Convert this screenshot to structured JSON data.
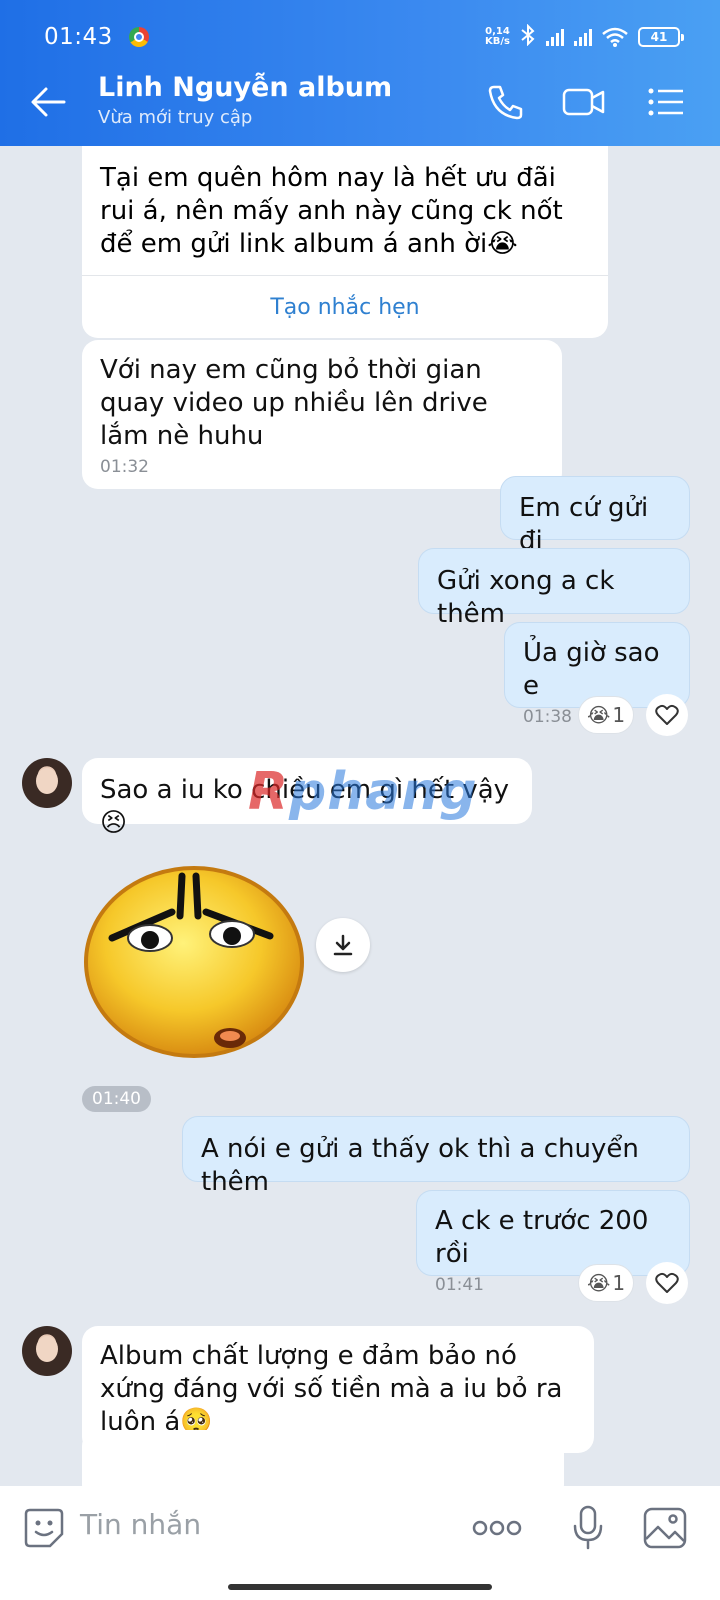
{
  "status_bar": {
    "time": "01:43",
    "net_speed_value": "0,14",
    "net_speed_unit": "KB/s",
    "battery": "41"
  },
  "header": {
    "contact_name": "Linh Nguyễn album",
    "contact_status": "Vừa mới truy cập",
    "icons": [
      "back-arrow-icon",
      "phone-icon",
      "video-call-icon",
      "menu-list-icon"
    ]
  },
  "messages": [
    {
      "direction": "in",
      "text": "Tại em quên hôm nay là hết ưu đãi rui á, nên mấy anh này cũng ck nốt để em gửi link album á anh ời😭",
      "action": "Tạo nhắc hẹn"
    },
    {
      "direction": "in",
      "text": "Với nay em cũng bỏ thời gian quay video up nhiều lên drive lắm nè huhu",
      "time": "01:32"
    },
    {
      "direction": "out",
      "text": "Em cứ gửi đi"
    },
    {
      "direction": "out",
      "text": "Gửi xong a ck thêm"
    },
    {
      "direction": "out",
      "text": "Ủa giờ sao e",
      "time": "01:38",
      "reaction": {
        "emoji": "😭",
        "count": "1"
      }
    },
    {
      "direction": "in",
      "text": "Sao a iu ko chiều em gì hết vậy 😣"
    },
    {
      "direction": "in",
      "type": "sticker",
      "sticker": "sad-emoji-sticker",
      "time": "01:40"
    },
    {
      "direction": "out",
      "text": "A nói e gửi a thấy ok thì a chuyển thêm"
    },
    {
      "direction": "out",
      "text": "A ck e trước 200 rồi",
      "time": "01:41",
      "reaction": {
        "emoji": "😭",
        "count": "1"
      }
    },
    {
      "direction": "in",
      "text": "Album chất lượng e đảm bảo nó xứng đáng với số tiền mà a iu bỏ ra luôn á🥺"
    }
  ],
  "watermark": {
    "part1": "R",
    "part2": "phang"
  },
  "input": {
    "placeholder": "Tin nhắn",
    "icons": [
      "sticker-icon",
      "more-icon",
      "microphone-icon",
      "image-icon"
    ]
  },
  "colors": {
    "header_start": "#1f6fe6",
    "header_end": "#4aa0f3",
    "chat_bg": "#e3e8ef",
    "bubble_out": "#d9ecfd",
    "bubble_in": "#ffffff",
    "link": "#2f80d0"
  }
}
